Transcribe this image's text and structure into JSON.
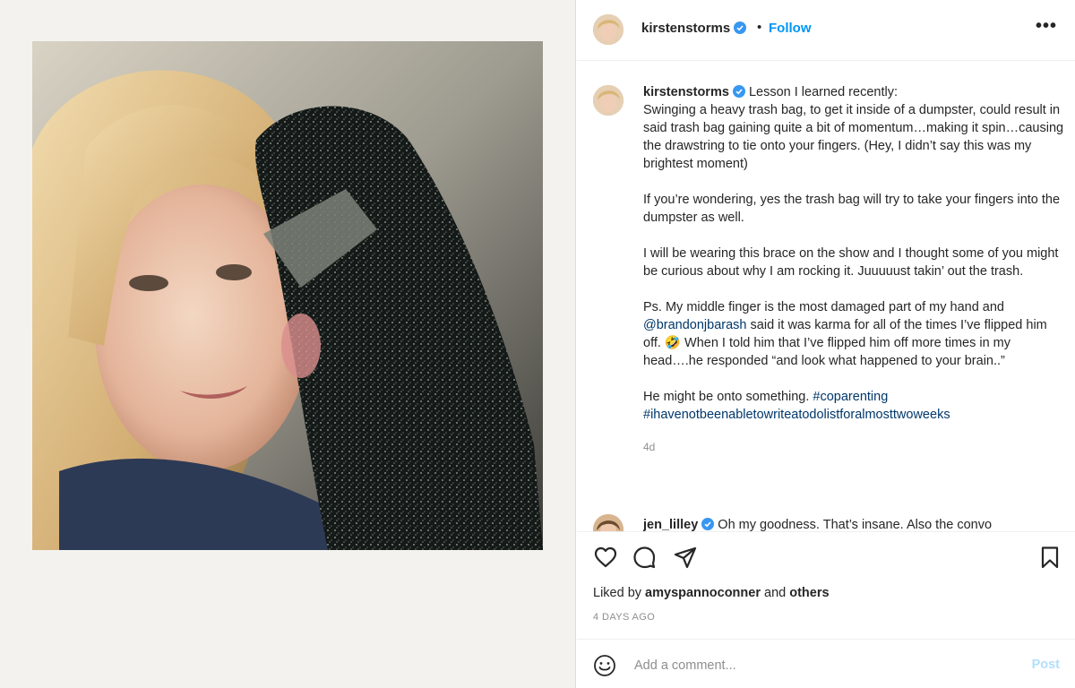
{
  "post": {
    "author": "kirstenstorms",
    "follow_label": "Follow",
    "separator": "•",
    "more_label": "•••"
  },
  "caption": {
    "author": "kirstenstorms",
    "lines": {
      "p1_start": "Lesson I learned recently:",
      "p1_rest": "Swinging a heavy trash bag, to get it inside of a dumpster, could result in said trash bag gaining quite a bit of momentum…making it spin…causing the drawstring to tie onto your fingers. (Hey, I didn’t say this was my brightest moment)",
      "p2": "If you’re wondering, yes the trash bag will try to take your fingers into the dumpster as well.",
      "p3": "I will be wearing this brace on the show and I thought some of you might be curious about why I am rocking it. Juuuuust takin’ out the trash.",
      "p4_mention": "@brandonjbarash",
      "p4_pre": "Ps. My middle finger is the most damaged part of my hand and",
      "p4_post": "said it was karma for all of the times I’ve flipped him off.",
      "p4_emoji": "🤣",
      "p4_end": "When I told him that I’ve flipped him off more times in my head….he responded “and look what happened to your brain..”",
      "p5_pre": "He might be onto something.",
      "hashtag1": "#coparenting",
      "hashtag2": "#ihavenotbeenabletowriteatodolistforalmosttwoweeks"
    },
    "time_ago": "4d"
  },
  "reply": {
    "author": "jen_lilley",
    "text": "Oh my goodness. That’s insane. Also the convo"
  },
  "likes": {
    "prefix": "Liked by",
    "user": "amyspannoconner",
    "and": "and",
    "others": "others"
  },
  "date": "4 DAYS AGO",
  "comment_box": {
    "placeholder": "Add a comment...",
    "post_label": "Post"
  },
  "icons": {
    "like": "heart-icon",
    "comment": "comment-icon",
    "share": "share-icon",
    "save": "bookmark-icon",
    "emoji": "emoji-icon",
    "verified": "verified-badge-icon"
  },
  "colors": {
    "link": "#0095f6",
    "mention": "#00376b",
    "verified": "#3897f0",
    "muted": "#8e8e8e",
    "post_disabled": "#b2dffc"
  }
}
